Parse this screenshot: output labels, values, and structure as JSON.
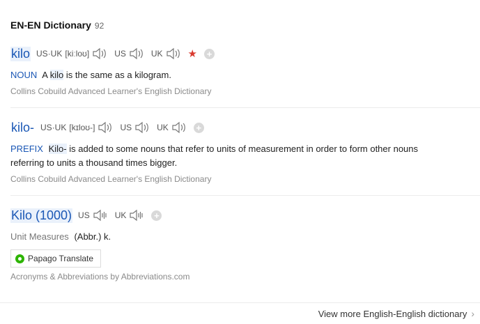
{
  "header": {
    "title": "EN-EN Dictionary",
    "count": "92"
  },
  "entries": [
    {
      "word": "kilo",
      "pron_main_label": "US·UK",
      "phonetic": "[kiːloʊ]",
      "us_label": "US",
      "uk_label": "UK",
      "starred": true,
      "pos": "NOUN",
      "def_pre": "A",
      "def_mark": "kilo",
      "def_post": "is the same as a kilogram.",
      "source": "Collins Cobuild Advanced Learner's English Dictionary"
    },
    {
      "word": "kilo-",
      "pron_main_label": "US·UK",
      "phonetic": "[kɪloʊ-]",
      "us_label": "US",
      "uk_label": "UK",
      "pos": "PREFIX",
      "def_mark": "Kilo-",
      "def_post": "is added to some nouns that refer to units of measurement in order to form other nouns referring to units a thousand times bigger.",
      "source": "Collins Cobuild Advanced Learner's English Dictionary"
    },
    {
      "word": "Kilo (1000)",
      "us_label": "US",
      "uk_label": "UK",
      "category": "Unit Measures",
      "abbr": "(Abbr.) k.",
      "translate_button": "Papago Translate",
      "source": "Acronyms & Abbreviations by Abbreviations.com"
    }
  ],
  "footer": {
    "view_more": "View more English-English dictionary"
  }
}
